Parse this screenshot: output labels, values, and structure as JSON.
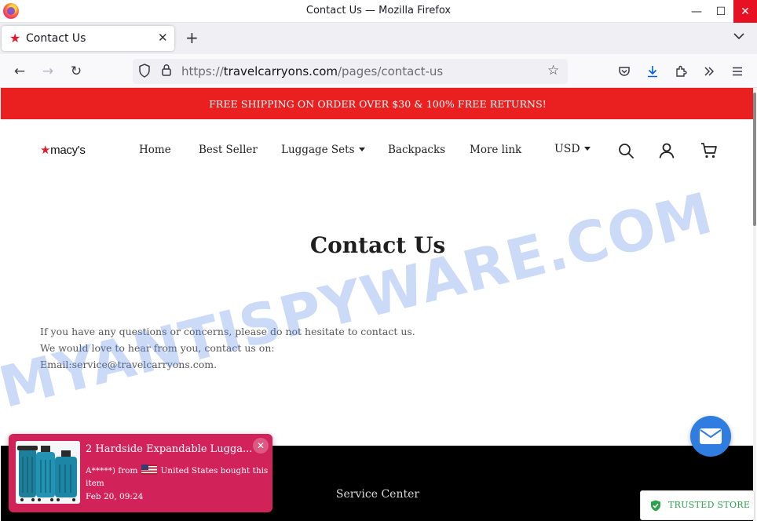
{
  "window": {
    "title": "Contact Us — Mozilla Firefox",
    "minimize_glyph": "—",
    "maximize_glyph": "☐",
    "close_glyph": "✕"
  },
  "tab": {
    "label": "Contact Us",
    "favicon": "★",
    "close_glyph": "✕",
    "new_tab_glyph": "+",
    "list_glyph": "⌄"
  },
  "nav": {
    "back_glyph": "←",
    "forward_glyph": "→",
    "reload_glyph": "↻",
    "url_scheme": "https://",
    "url_domain": "travelcarryons.com",
    "url_path": "/pages/contact-us",
    "bookmark_glyph": "☆",
    "icons": [
      "shield-icon",
      "lock-icon",
      "pocket-icon",
      "download-icon",
      "extensions-icon",
      "overflow-icon",
      "menu-icon"
    ]
  },
  "promo": {
    "text": "FREE SHIPPING ON ORDER OVER $30 & 100% FREE RETURNS!",
    "color": "#ea2020"
  },
  "header": {
    "logo_star": "★",
    "logo_text": "macy's",
    "menu": [
      "Home",
      "Best Seller",
      "Luggage Sets",
      "Backpacks",
      "More link"
    ],
    "currency": "USD"
  },
  "main": {
    "title": "Contact Us",
    "lines": [
      "If you have any questions or concerns, please do not hesitate to contact us.",
      "We would love to hear from you, contact us on:",
      "Email:service@travelcarryons.com."
    ]
  },
  "footer": {
    "title": "Service Center"
  },
  "watermark": {
    "text": "MYANTISPYWARE.COM"
  },
  "popup": {
    "title": "2 Hardside Expandable Lugga...",
    "buyer": "A*****) from",
    "location": "United States bought this",
    "item_word": "item",
    "time": "Feb 20, 09:24",
    "close_glyph": "✕",
    "color": "#d2225a"
  },
  "trusted": {
    "label": "TRUSTED STORE"
  },
  "colors": {
    "accent_blue": "#2f7de1",
    "trusted_green": "#2ca24d"
  }
}
